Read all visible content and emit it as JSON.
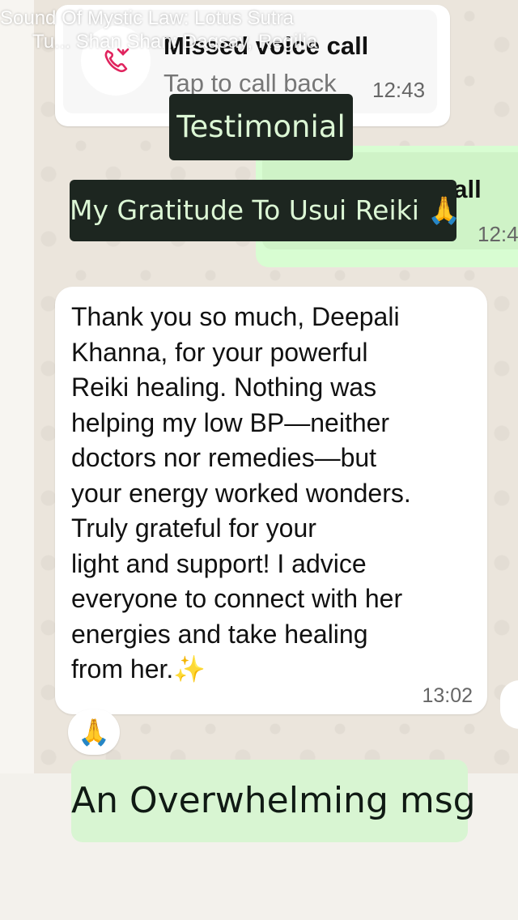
{
  "ticker": {
    "line1": "Sound Of Mystic Law: Lotus Sutra",
    "line2": "Tu... Shan Shan: Dagsay, Regilia"
  },
  "missed_call": {
    "title": "Missed voice call",
    "subtitle": "Tap to call back",
    "time": "12:43",
    "icon": "missed-call-icon",
    "icon_color": "#e0245e"
  },
  "voice_call": {
    "title": "Voice call",
    "time": "12:4"
  },
  "overlay_labels": {
    "testimonial": "Testimonial",
    "gratitude": "My Gratitude To Usui Reiki 🙏"
  },
  "message": {
    "text": "Thank you so much, Deepali\nKhanna, for your powerful\nReiki healing. Nothing was\nhelping my low BP—neither\ndoctors nor remedies—but\nyour energy worked wonders.\nTruly grateful for your\nlight and support! I advice\neveryone to connect with her\nenergies and take healing\nfrom her.✨",
    "time": "13:02",
    "reaction": "🙏"
  },
  "footer": {
    "caption": "An Overwhelming msg"
  },
  "colors": {
    "chat_bg": "#ebe5dc",
    "outgoing_bubble": "#d8fdd2",
    "label_bg": "#1d2620",
    "label_text": "#dcf7d5",
    "footer_bg": "#d8f5d2"
  }
}
